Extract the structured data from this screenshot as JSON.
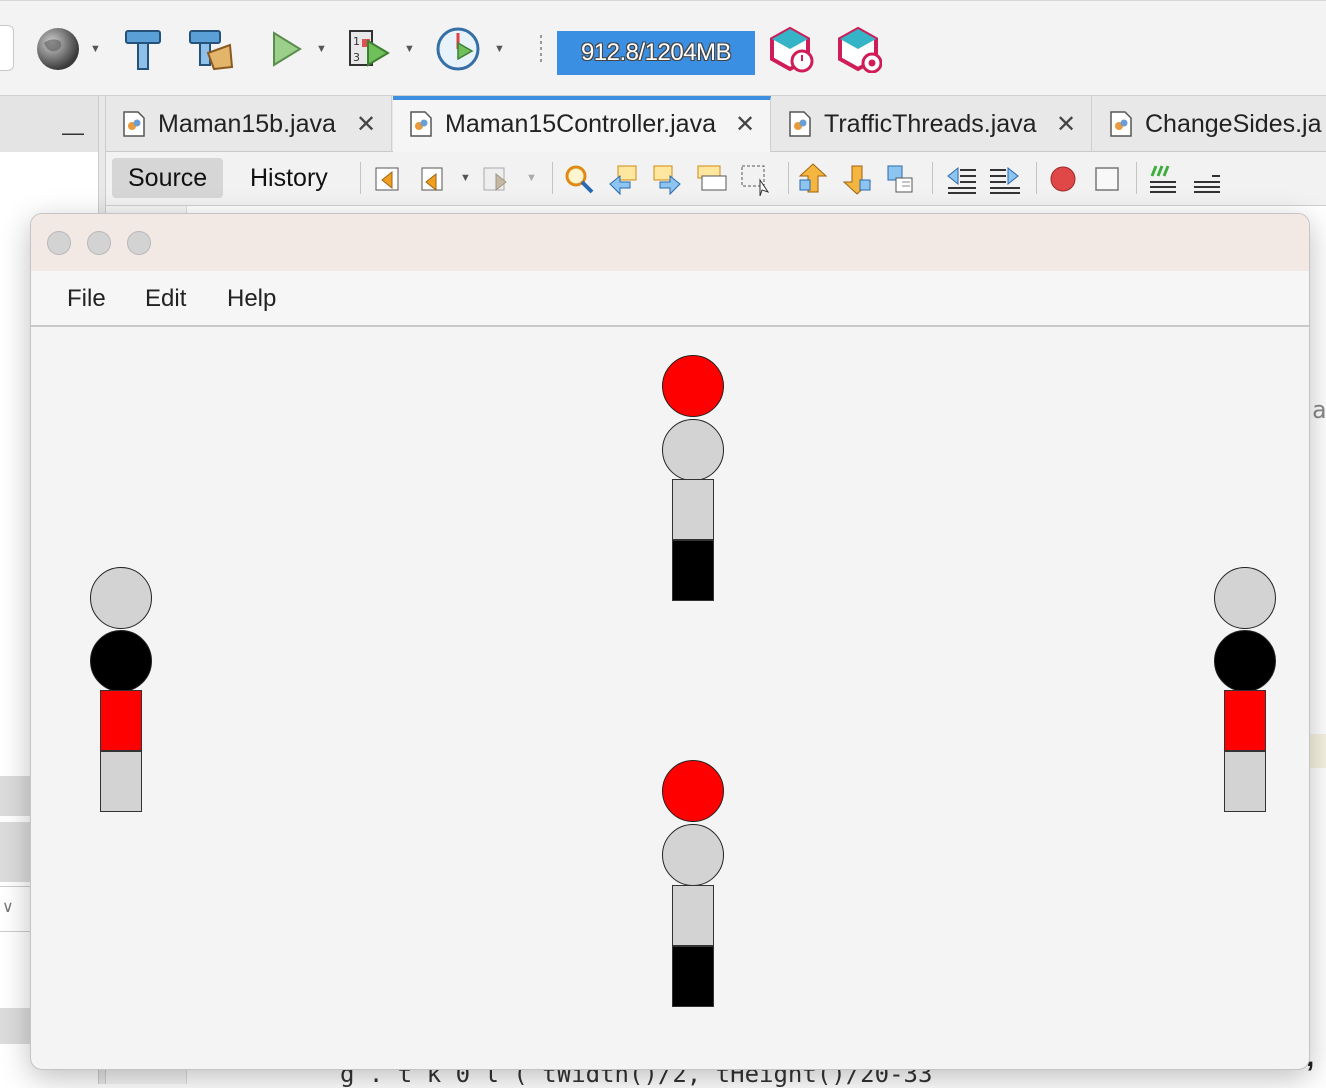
{
  "ide": {
    "toolbar": {
      "memory_label": "912.8/1204MB",
      "icons": [
        "globe-icon",
        "hammer-icon",
        "clean-build-icon",
        "run-icon",
        "debug-icon",
        "profile-icon",
        "profile-ide-icon",
        "snapshot-icon"
      ]
    },
    "tabs": [
      {
        "label": "Maman15b.java",
        "active": false
      },
      {
        "label": "Maman15Controller.java",
        "active": true
      },
      {
        "label": "TrafficThreads.java",
        "active": false
      },
      {
        "label": "ChangeSides.ja",
        "active": false
      }
    ],
    "editor_toolbar": {
      "source_label": "Source",
      "history_label": "History"
    },
    "left_panel": {
      "minimize_label": "—"
    },
    "code": {
      "peek_char": "a",
      "bottom_text": "g  .  t  k  0  l  (          tWidth()/2,          tHeight()/20-33",
      "comma": ","
    }
  },
  "app": {
    "menu": [
      "File",
      "Edit",
      "Help"
    ],
    "colors": {
      "red": "#ff0000",
      "gray": "#d3d3d3",
      "black": "#000000"
    },
    "traffic_lights": [
      {
        "position": "top",
        "upper_lamp": "red",
        "lower_lamp": "gray",
        "upper_walk": "gray",
        "lower_walk": "black"
      },
      {
        "position": "bottom",
        "upper_lamp": "red",
        "lower_lamp": "gray",
        "upper_walk": "gray",
        "lower_walk": "black"
      },
      {
        "position": "left",
        "upper_lamp": "gray",
        "lower_lamp": "black",
        "upper_walk": "red",
        "lower_walk": "gray"
      },
      {
        "position": "right",
        "upper_lamp": "gray",
        "lower_lamp": "black",
        "upper_walk": "red",
        "lower_walk": "gray"
      }
    ]
  }
}
